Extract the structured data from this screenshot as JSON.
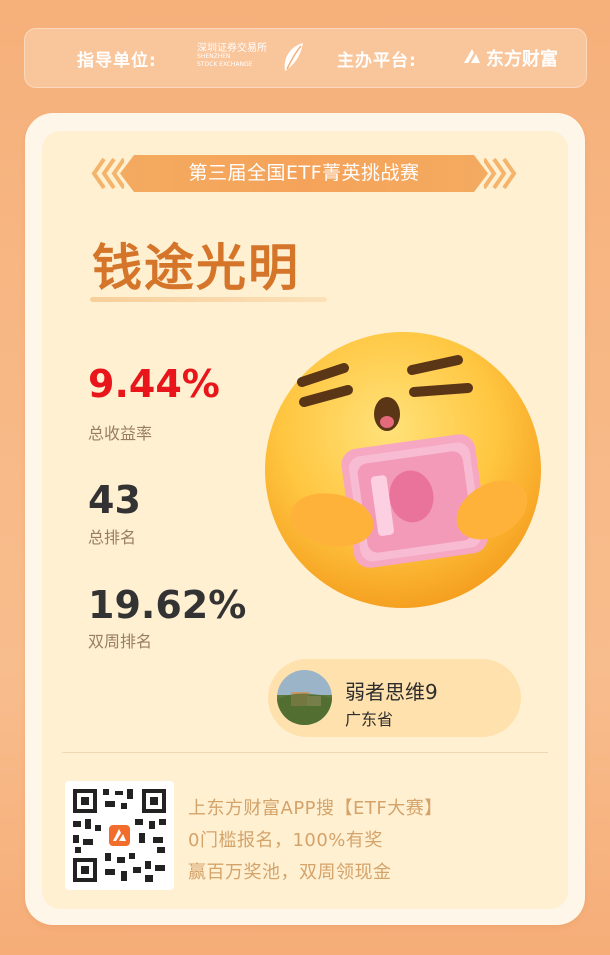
{
  "header": {
    "guide_label": "指导单位:",
    "szse_cn": "深圳证券交易所",
    "szse_en_1": "SHENZHEN",
    "szse_en_2": "STOCK EXCHANGE",
    "host_label": "主办平台:",
    "host_brand": "东方财富"
  },
  "card": {
    "contest_title": "第三届全国ETF菁英挑战赛",
    "team_name": "钱途光明",
    "stats": [
      {
        "value": "9.44%",
        "label": "总收益率",
        "color": "#e8151b"
      },
      {
        "value": "43",
        "label": "总排名",
        "color": "#333333"
      },
      {
        "value": "19.62%",
        "label": "双周排名",
        "color": "#333333"
      }
    ],
    "emoji_icon": "face-holding-money-emoji",
    "user": {
      "name": "弱者思维9",
      "region": "广东省"
    }
  },
  "footer": {
    "qr_icon": "qr-code",
    "promo_lines": [
      "上东方财富APP搜【ETF大赛】",
      "0门槛报名，100%有奖",
      "赢百万奖池，双周领现金"
    ]
  },
  "colors": {
    "background": "#f7b784",
    "card": "#fff0d2",
    "accent": "#f5a35a",
    "title": "#d5752a",
    "red": "#e8151b",
    "promo_text": "#d4a36a"
  }
}
